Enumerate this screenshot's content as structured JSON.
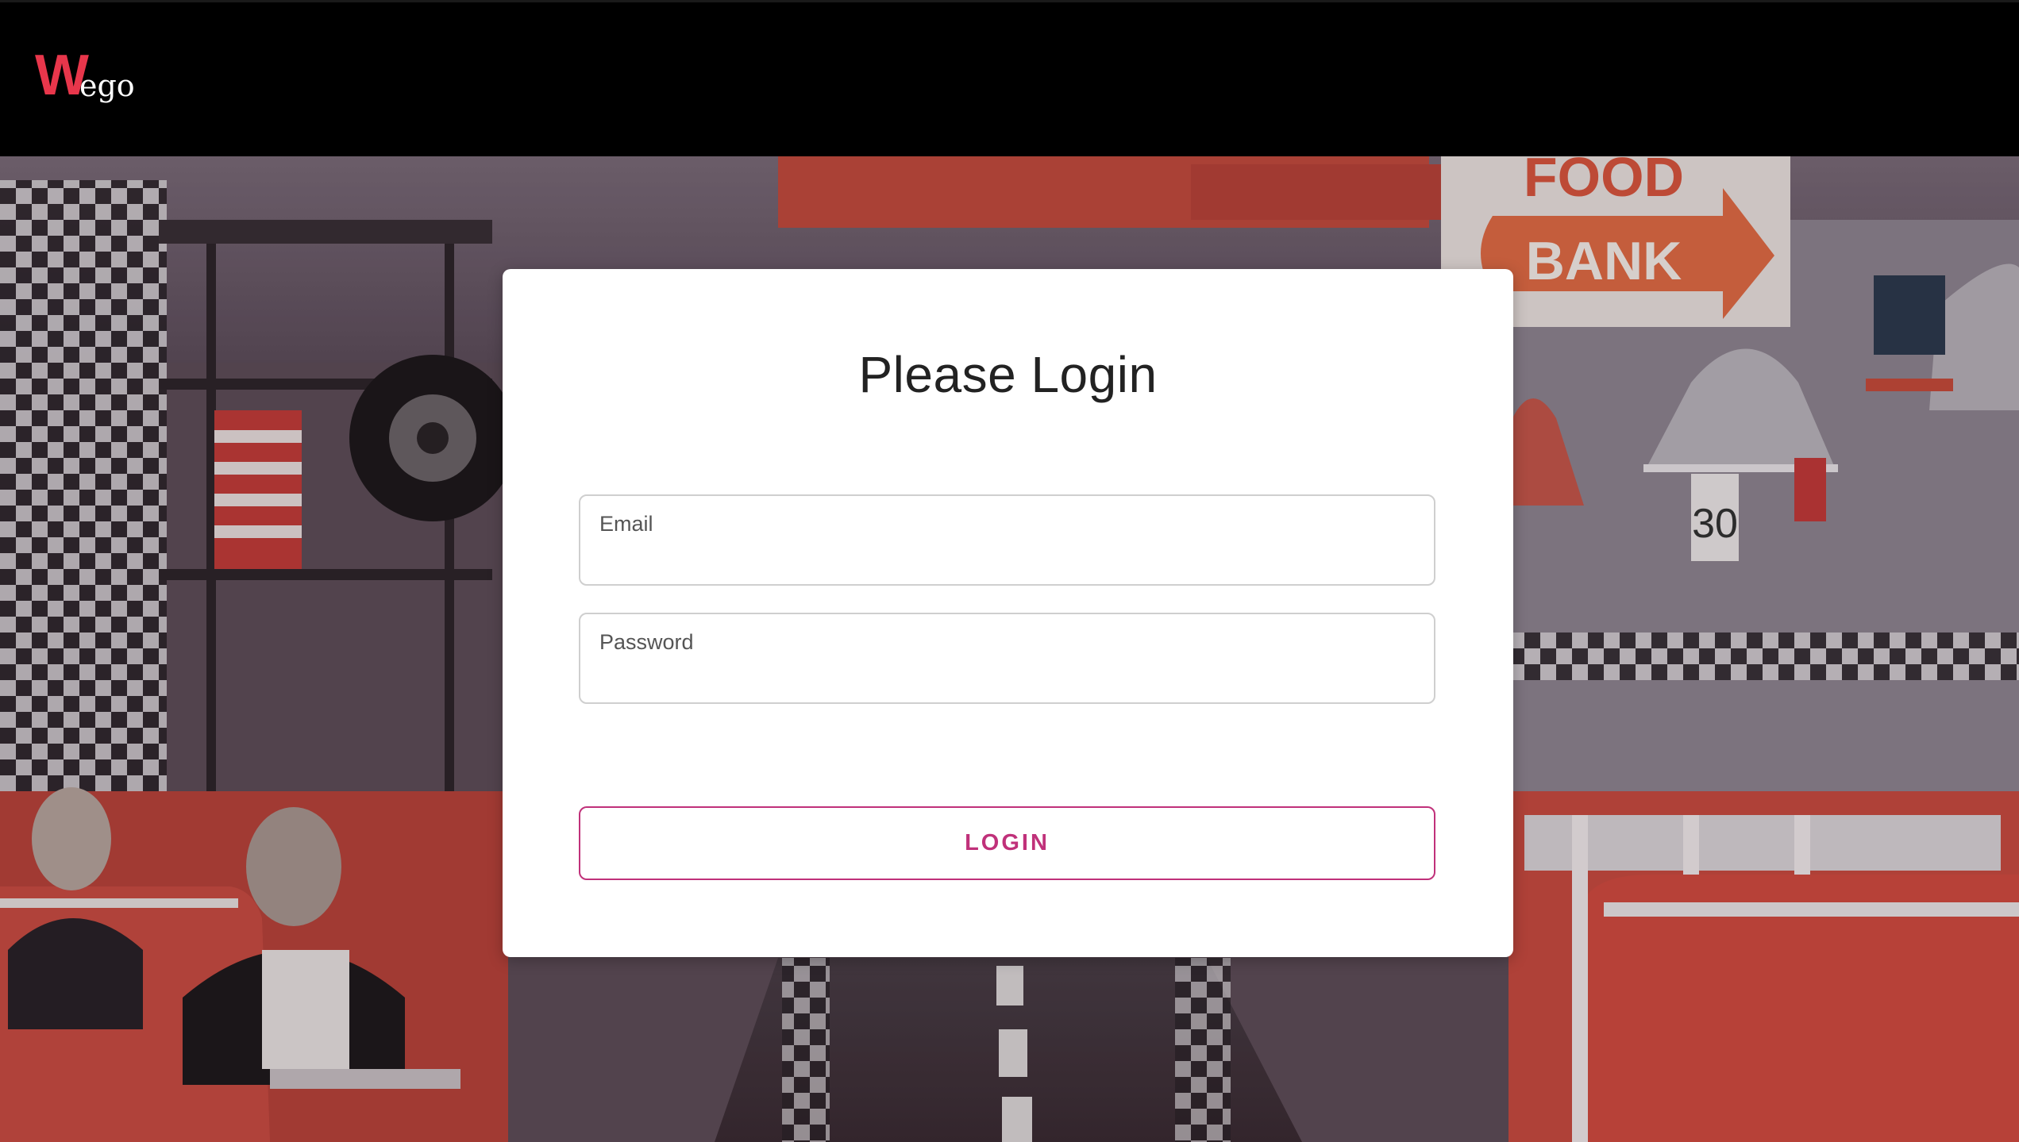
{
  "header": {
    "logo_initial": "W",
    "logo_rest": "ego"
  },
  "login_card": {
    "title": "Please Login",
    "email_label": "Email",
    "email_value": "",
    "password_label": "Password",
    "password_value": "",
    "login_button_label": "LOGIN"
  },
  "colors": {
    "brand_red": "#e8364b",
    "accent_magenta": "#c0317a",
    "header_bg": "#000000"
  },
  "icons": {
    "logo": "wego-logo"
  }
}
